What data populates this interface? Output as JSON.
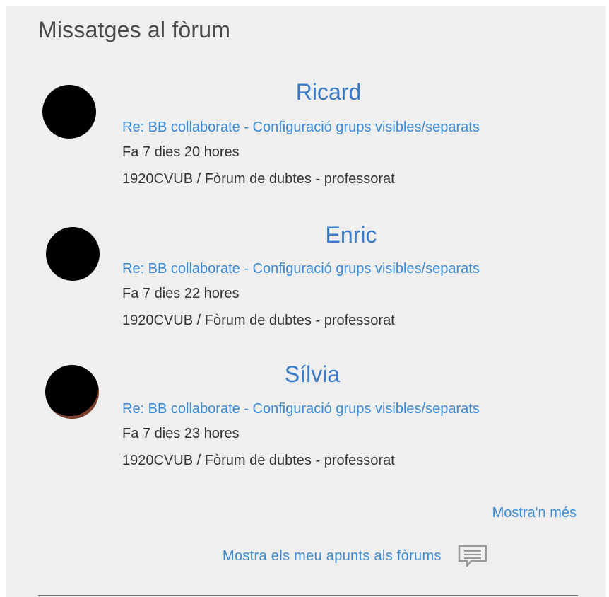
{
  "block": {
    "title": "Missatges al fòrum"
  },
  "posts": [
    {
      "author": "Ricard",
      "subject": "Re: BB collaborate - Configuració grups visibles/separats",
      "time": "Fa 7 dies 20 hores",
      "forum": "1920CVUB / Fòrum de dubtes - professorat"
    },
    {
      "author": "Enric",
      "subject": "Re: BB collaborate - Configuració grups visibles/separats",
      "time": "Fa 7 dies 22 hores",
      "forum": "1920CVUB / Fòrum de dubtes - professorat"
    },
    {
      "author": "Sílvia",
      "subject": "Re: BB collaborate - Configuració grups visibles/separats",
      "time": "Fa 7 dies 23 hores",
      "forum": "1920CVUB / Fòrum de dubtes - professorat"
    }
  ],
  "footer": {
    "more_label": "Mostra'n més",
    "notes_label": "Mostra els meu apunts als fòrums",
    "notes_icon": "chat-icon"
  },
  "colors": {
    "link": "#3a8ad6",
    "author": "#3a7bc8",
    "panel_bg": "#efefef",
    "text": "#333333"
  }
}
